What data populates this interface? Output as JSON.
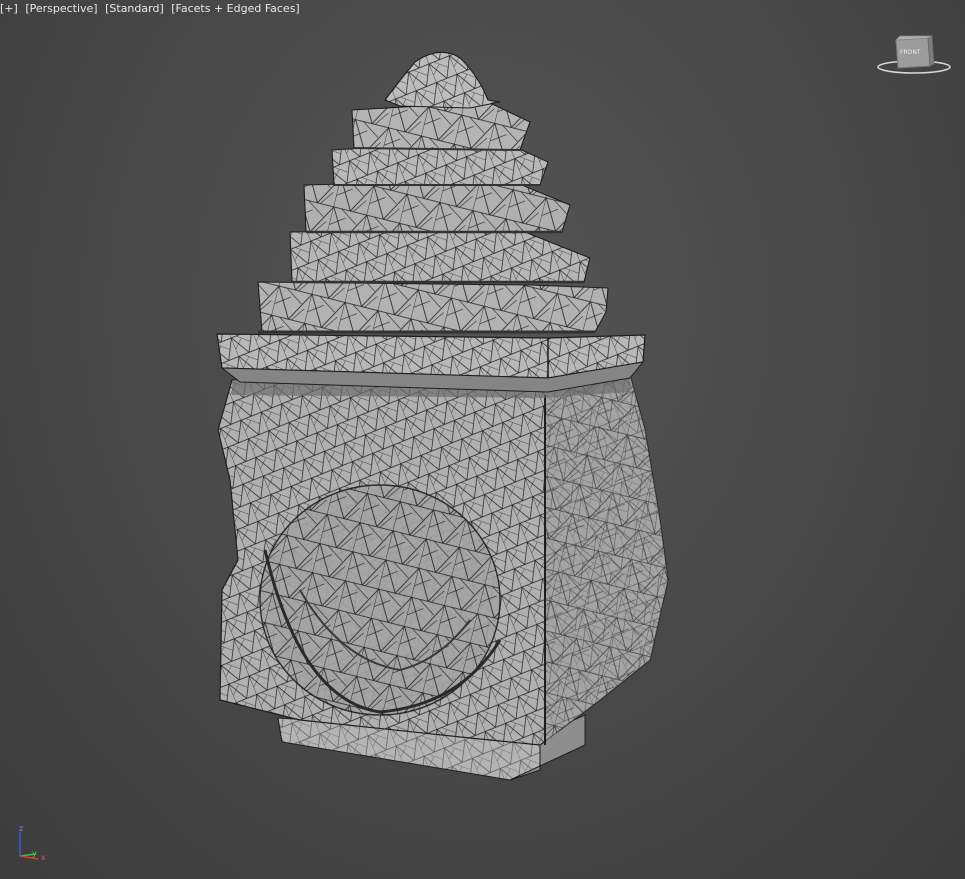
{
  "viewport": {
    "labels": [
      "[+]",
      "[Perspective]",
      "[Standard]",
      "[Facets + Edged Faces]"
    ]
  },
  "viewcube": {
    "face_label": "FRONT"
  },
  "axis": {
    "z": "z",
    "y": "y",
    "x": "x"
  },
  "colors": {
    "background": "#4a4a4a",
    "mesh_fill": "#a8a8a8",
    "mesh_edge": "#1e1e1e",
    "label_text": "#e8e8e8"
  }
}
